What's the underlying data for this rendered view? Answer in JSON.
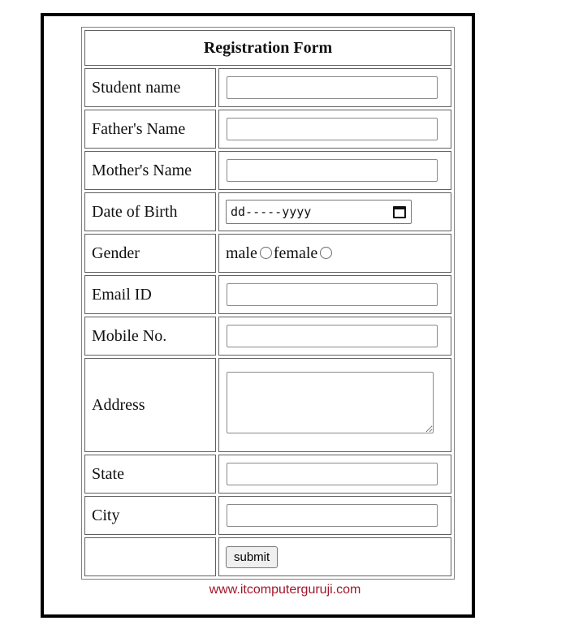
{
  "form": {
    "title": "Registration Form",
    "fields": {
      "student_name_label": "Student name",
      "fathers_name_label": "Father's Name",
      "mothers_name_label": "Mother's Name",
      "dob_label": "Date of Birth",
      "dob_placeholder": "dd-----yyyy",
      "gender_label": "Gender",
      "gender_male": "male",
      "gender_female": "female",
      "email_label": "Email ID",
      "mobile_label": "Mobile No.",
      "address_label": "Address",
      "state_label": "State",
      "city_label": "City"
    },
    "submit_label": "submit"
  },
  "footer": {
    "url_text": "www.itcomputerguruji.com"
  },
  "colors": {
    "frame": "#000000",
    "footer_text": "#a0162a"
  },
  "icons": {
    "date_picker": "calendar-icon"
  }
}
